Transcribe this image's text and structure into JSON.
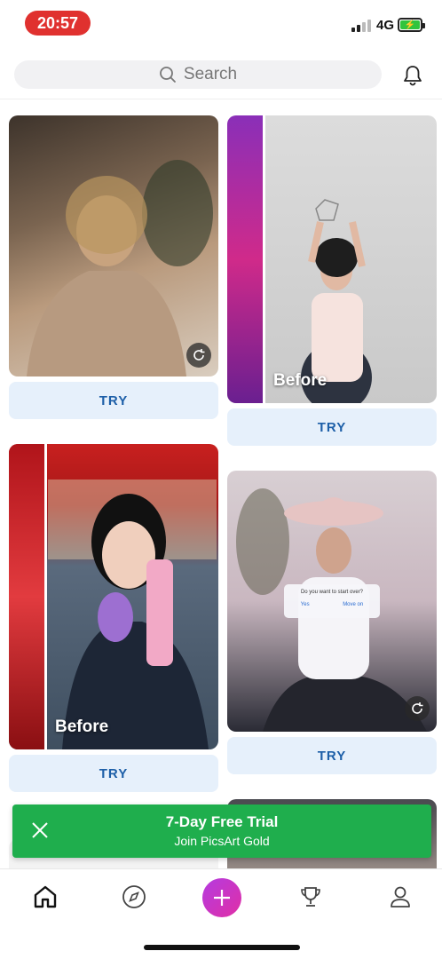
{
  "status_bar": {
    "time": "20:57",
    "network": "4G"
  },
  "search": {
    "placeholder": "Search"
  },
  "cards": {
    "try_label": "TRY",
    "before_label": "Before"
  },
  "dialog": {
    "question": "Do you want to start over?",
    "yes": "Yes",
    "move_on": "Move on"
  },
  "trial_banner": {
    "title": "7-Day Free Trial",
    "subtitle": "Join PicsArt Gold"
  },
  "tabs": [
    "home-icon",
    "compass-icon",
    "create-plus-icon",
    "trophy-icon",
    "profile-icon"
  ],
  "colors": {
    "accent_green": "#1fae4d",
    "try_bg": "#e6f0fb",
    "try_text": "#1d5fa8",
    "time_pill": "#e0312f",
    "create_gradient_start": "#b43be0",
    "create_gradient_end": "#e02fa6"
  }
}
